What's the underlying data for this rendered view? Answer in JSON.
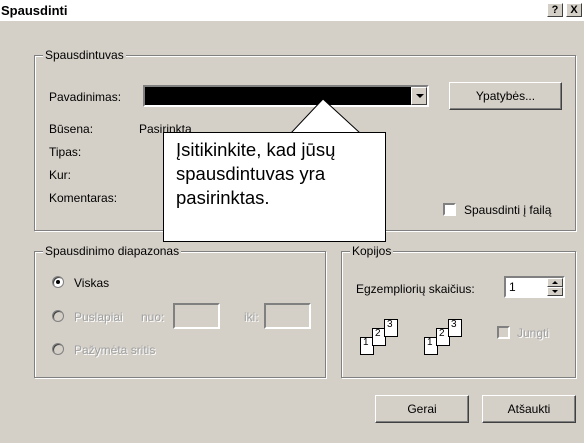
{
  "window": {
    "title": "Spausdinti",
    "help_label": "?",
    "close_label": "X"
  },
  "printer": {
    "legend": "Spausdintuvas",
    "name_label": "Pavadinimas:",
    "properties_label": "Ypatybės...",
    "status_label": "Būsena:",
    "status_value": "Pasirinkta",
    "type_label": "Tipas:",
    "where_label": "Kur:",
    "comment_label": "Komentaras:",
    "print_to_file_label": "Spausdinti į failą",
    "print_to_file_checked": false
  },
  "callout": {
    "lines": [
      "Įsitikinkite, kad jūsų",
      "spausdintuvas yra",
      "pasirinktas."
    ]
  },
  "range": {
    "legend": "Spausdinimo diapazonas",
    "all_label": "Viskas",
    "pages_label": "Puslapiai",
    "from_label": "nuo:",
    "to_label": "iki:",
    "selection_label": "Pažymėta sritis",
    "selected": "all"
  },
  "copies": {
    "legend": "Kopijos",
    "count_label": "Egzempliorių skaičius:",
    "count_value": "1",
    "collate_label": "Jungti",
    "collate_checked": false,
    "page_numbers": [
      "1",
      "2",
      "3"
    ]
  },
  "buttons": {
    "ok_label": "Gerai",
    "cancel_label": "Atšaukti"
  }
}
